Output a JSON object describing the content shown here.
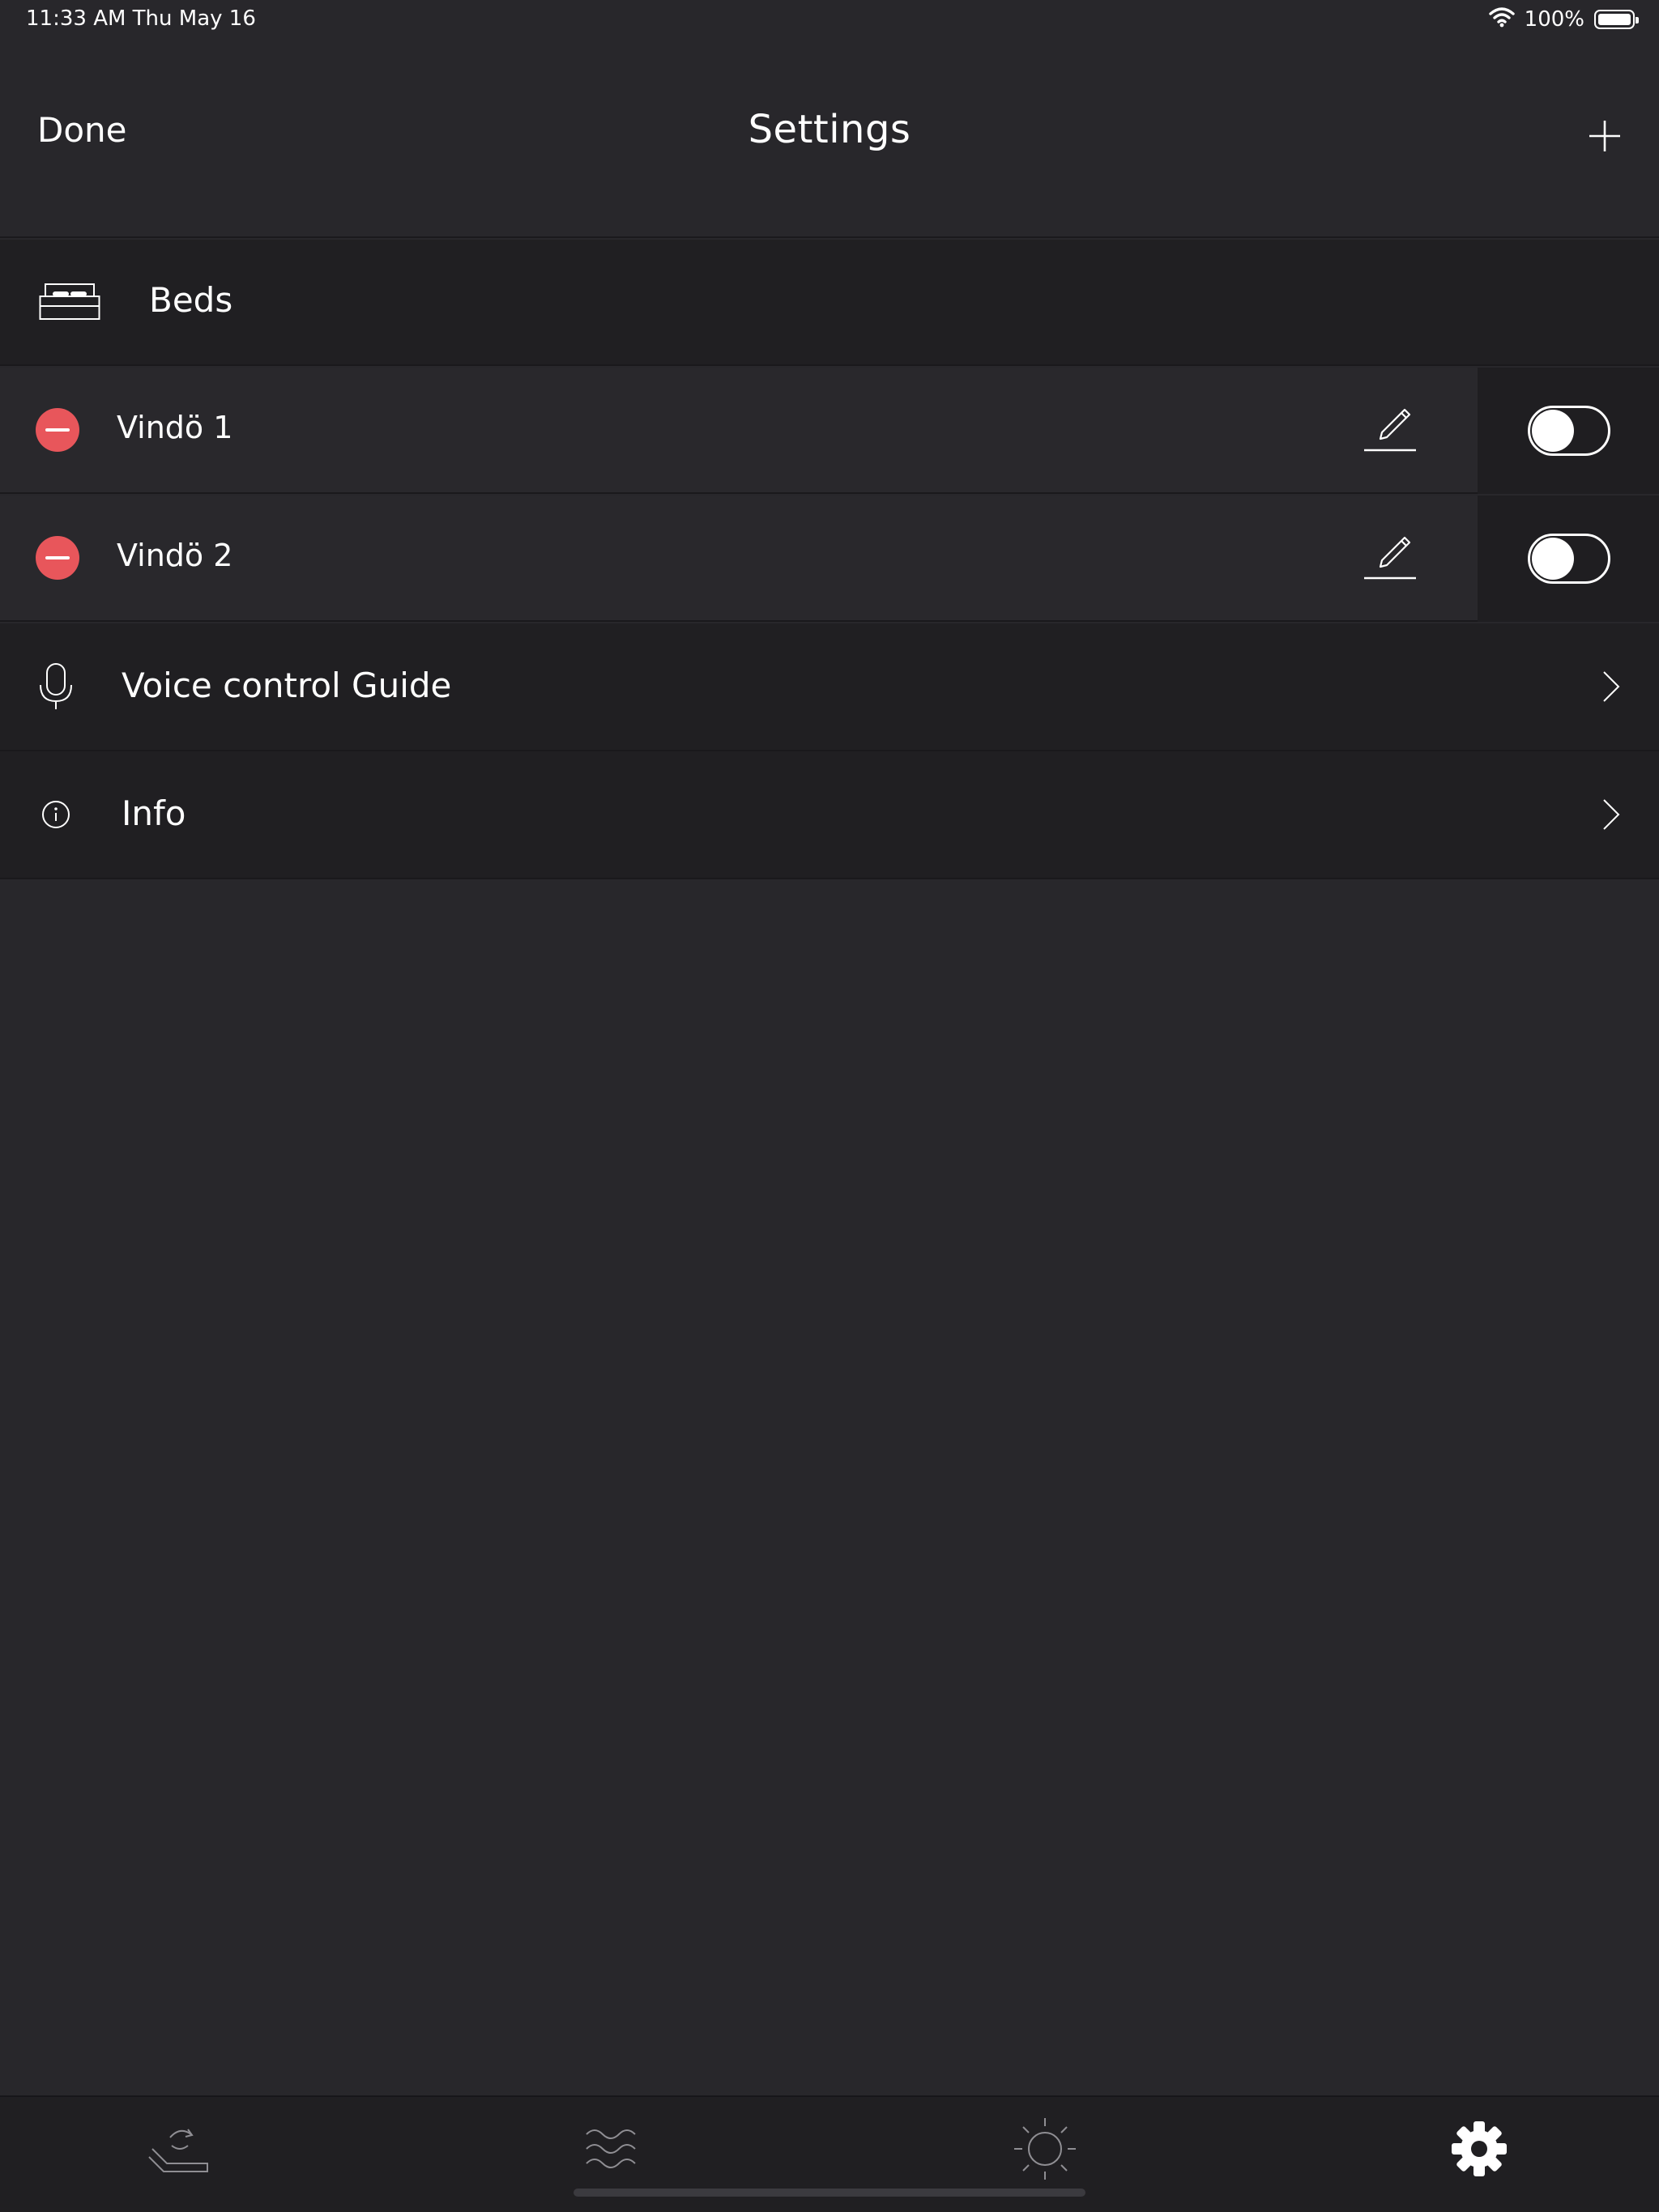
{
  "status_bar": {
    "time_date": "11:33 AM   Thu May 16",
    "battery_percent": "100%",
    "wifi_icon": "wifi-icon",
    "battery_icon": "battery-icon"
  },
  "nav": {
    "done_label": "Done",
    "title": "Settings",
    "add_icon": "plus-icon"
  },
  "beds_section": {
    "title": "Beds",
    "icon": "bed-icon",
    "items": [
      {
        "name": "Vindö 1",
        "enabled": false
      },
      {
        "name": "Vindö 2",
        "enabled": false
      }
    ]
  },
  "menu": {
    "voice_label": "Voice control Guide",
    "voice_icon": "microphone-icon",
    "info_label": "Info",
    "info_icon": "info-icon"
  },
  "tab_bar": {
    "tabs": [
      {
        "icon": "position-icon",
        "selected": false
      },
      {
        "icon": "massage-waves-icon",
        "selected": false
      },
      {
        "icon": "light-sun-icon",
        "selected": false
      },
      {
        "icon": "settings-gear-icon",
        "selected": true
      }
    ]
  },
  "colors": {
    "background": "#28272b",
    "row_dark": "#201f22",
    "delete_red": "#e8565b",
    "text": "#ffffff"
  }
}
